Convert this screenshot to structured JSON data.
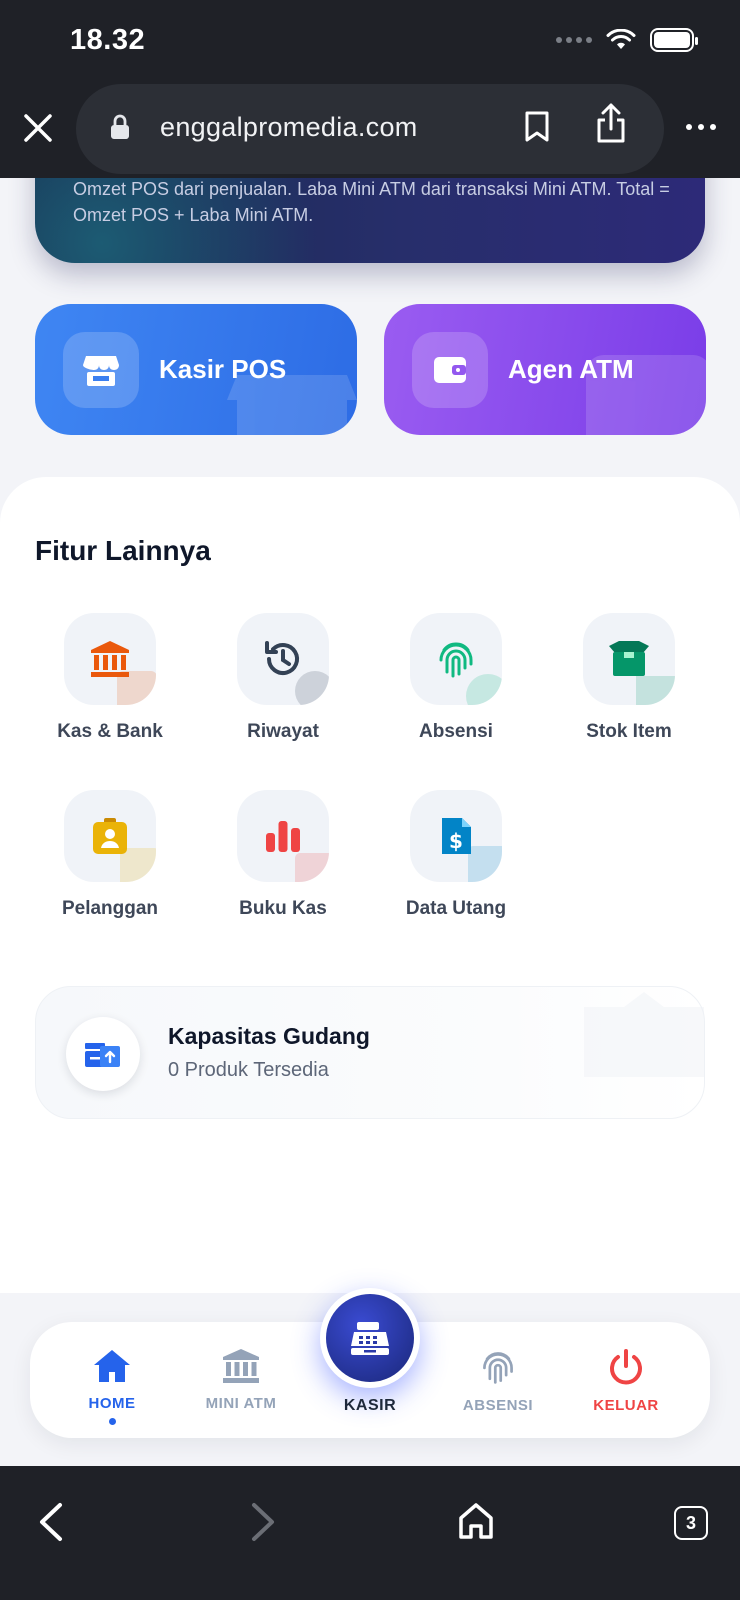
{
  "status_bar": {
    "time": "18.32"
  },
  "browser": {
    "url": "enggalpromedia.com",
    "tab_count": "3"
  },
  "hero": {
    "description": "Omzet POS dari penjualan. Laba Mini ATM dari transaksi Mini ATM. Total = Omzet POS + Laba Mini ATM."
  },
  "actions": [
    {
      "label": "Kasir POS",
      "icon": "store-icon"
    },
    {
      "label": "Agen ATM",
      "icon": "wallet-icon"
    }
  ],
  "features": {
    "title": "Fitur Lainnya",
    "items": [
      {
        "label": "Kas & Bank",
        "icon": "bank-icon",
        "color": "#ea580c"
      },
      {
        "label": "Riwayat",
        "icon": "history-icon",
        "color": "#334155"
      },
      {
        "label": "Absensi",
        "icon": "fingerprint-icon",
        "color": "#10b981"
      },
      {
        "label": "Stok Item",
        "icon": "box-icon",
        "color": "#059669"
      },
      {
        "label": "Pelanggan",
        "icon": "id-badge-icon",
        "color": "#eab308"
      },
      {
        "label": "Buku Kas",
        "icon": "bar-chart-icon",
        "color": "#ef4444"
      },
      {
        "label": "Data Utang",
        "icon": "invoice-icon",
        "color": "#0284c7"
      }
    ]
  },
  "storage": {
    "title": "Kapasitas Gudang",
    "subtitle": "0 Produk Tersedia"
  },
  "nav": {
    "home": "HOME",
    "mini_atm": "MINI ATM",
    "kasir": "KASIR",
    "absensi": "ABSENSI",
    "keluar": "KELUAR",
    "colors": {
      "active": "#2563eb",
      "inactive": "#94a3b8",
      "danger": "#ef4444"
    }
  }
}
